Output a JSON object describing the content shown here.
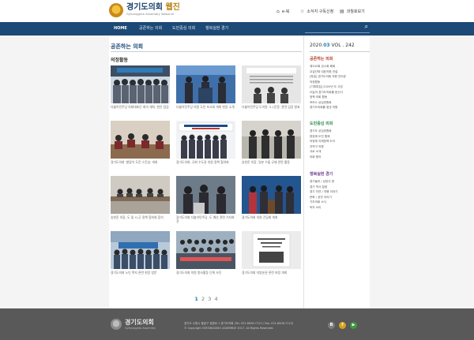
{
  "header": {
    "logo_title_main": "경기도의회",
    "logo_title_accent": "웹진",
    "logo_sub": "Gyeonggido Assembly Webzine",
    "util_links": [
      {
        "icon": "home-icon",
        "label": "e-북"
      },
      {
        "icon": "star-icon",
        "label": "소식지 구독신청"
      },
      {
        "icon": "book-icon",
        "label": "과월호보기"
      }
    ]
  },
  "nav": {
    "items": [
      "HOME",
      "공존하는 의회",
      "도민중심 의회",
      "행복실현 경기"
    ]
  },
  "main": {
    "section_title": "공존하는 의회",
    "sub_title": "의정활동",
    "cards": [
      {
        "caption": "더불어민주당 의회대표단 회의 개최, 현안 점검"
      },
      {
        "caption": "더불어민주당 의원 도민 보고회 개최 현장 소개"
      },
      {
        "caption": "더불어민주당 도의원 '3.1운동' 관련 입장 발표"
      },
      {
        "caption": "경기도의회 '봄맞이 도민 스킨십' 개최"
      },
      {
        "caption": "경기도의회, 국회 수도권 의원 정책 협의회"
      },
      {
        "caption": "송한준 의장, 일본 수출 규제 관련 활동"
      },
      {
        "caption": "송한준 의장, 도 및 시 군 정책 협의회 참석"
      },
      {
        "caption": "경기도의회 더불어민주당, 도 예산 관련 기자회견"
      },
      {
        "caption": "경기도의회 의원 간담회 개최"
      },
      {
        "caption": "경기도의회 노인 복지 관련 현장 방문"
      },
      {
        "caption": "경기도의회 의원 봉사활동 단체 사진"
      },
      {
        "caption": "경기도의회 지방분권 관련 포럼 개최"
      }
    ],
    "pagination": [
      "1",
      "2",
      "3",
      "4"
    ],
    "active_page": "1"
  },
  "sidebar": {
    "issue_year": "2020.",
    "issue_month": "03",
    "issue_vol": "VOL . 242",
    "sections": [
      {
        "title": "공존하는 의회",
        "color": "#b83a2a",
        "items": [
          "제342회 임시회 폐회",
          "교섭단체 대표의원 연설",
          "[특집] 경기도의회 의원 인터뷰",
          "의정활동",
          "[기획특집] 2020년 도 사업",
          "오늘의 경기도의회를 듣는다",
          "정책 의회 활동",
          "포커스 상임위원회",
          "경기도의회를 빛낸 의원"
        ]
      },
      {
        "title": "도민중심 의회",
        "color": "#2e8a4b",
        "items": [
          "경기도 상임위원회",
          "현장에 도민 함께",
          "의정에 자체정책 도지",
          "지역구 의원",
          "서로 소개",
          "의회 용어"
        ]
      },
      {
        "title": "행복실현 경기",
        "color": "#6d3a93",
        "items": [
          "경기둘러 / 남양주 편",
          "경기 역사 칼럼",
          "경기 자연 / 여행 이야기",
          "문화 / 공연 이야기",
          "기초의회 소식",
          "독자 소리"
        ]
      }
    ]
  },
  "footer": {
    "name": "경기도의회",
    "sub": "Gyeonggido Assembly",
    "address": "경기도 수원시 팔달구 효원로 1 경기도의회 (Tel. 031.8008.7113 / Fax. 031.8008.7115)",
    "copyright": "© Copyright GYEONGGIDO ASSEMBLY 2017. All Rights Reserved.",
    "social": [
      {
        "icon": "blog-icon",
        "glyph": "B",
        "color": "#7d7d7d"
      },
      {
        "icon": "facebook-icon",
        "glyph": "f",
        "color": "#d8a21e"
      },
      {
        "icon": "youtube-icon",
        "glyph": "▶",
        "color": "#3c9a3f"
      }
    ]
  }
}
